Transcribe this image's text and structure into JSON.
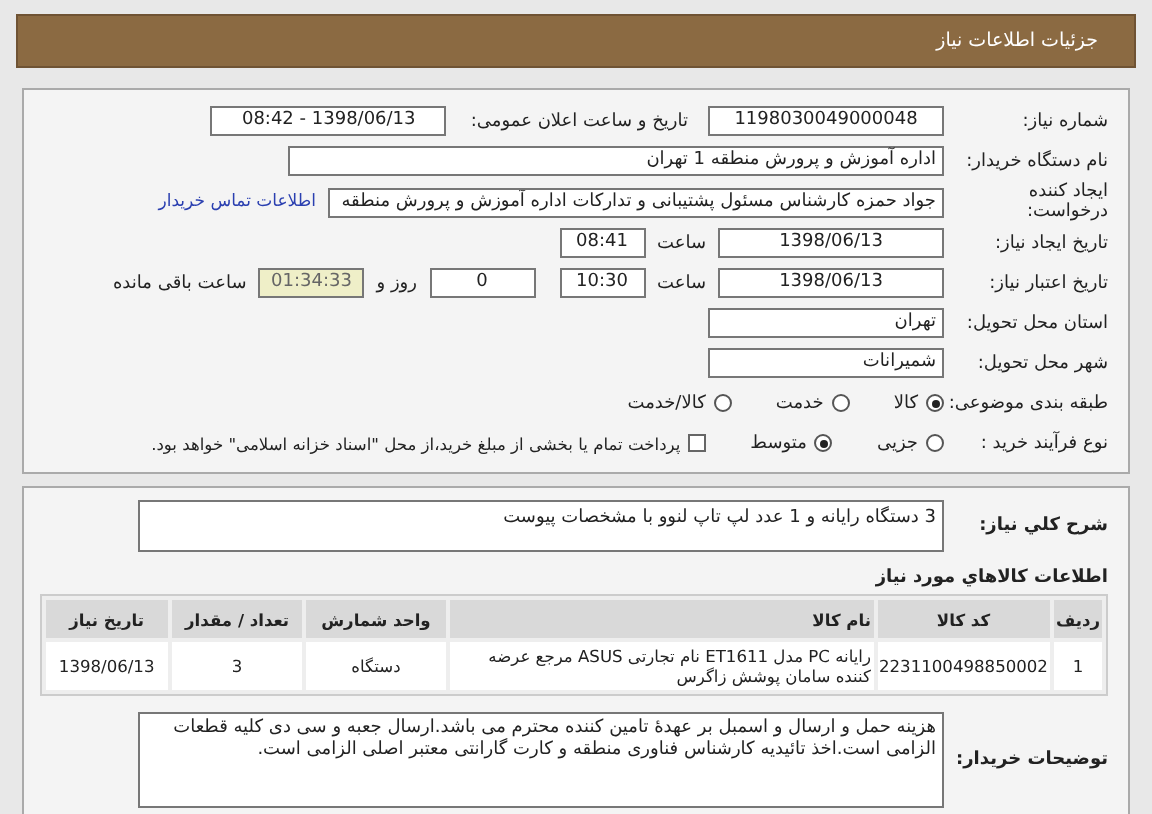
{
  "header": {
    "title": "جزئیات اطلاعات نیاز"
  },
  "need_number": {
    "label": "شماره نیاز:",
    "value": "1198030049000048"
  },
  "announce": {
    "label": "تاریخ و ساعت اعلان عمومی:",
    "value": "1398/06/13 - 08:42"
  },
  "buyer": {
    "label": "نام دستگاه خریدار:",
    "value": "اداره آموزش و پرورش منطقه 1 تهران"
  },
  "creator": {
    "label": "ایجاد کننده درخواست:",
    "value": "جواد حمزه کارشناس مسئول پشتیبانی و تدارکات اداره آموزش و پرورش منطقه",
    "link": "اطلاعات تماس خریدار"
  },
  "created": {
    "label": "تاریخ ایجاد نیاز:",
    "date": "1398/06/13",
    "time_label": "ساعت",
    "time": "08:41"
  },
  "validity": {
    "label": "تاریخ اعتبار نیاز:",
    "date": "1398/06/13",
    "time_label": "ساعت",
    "time": "10:30",
    "days": "0",
    "days_label": "روز و",
    "remaining": "01:34:33",
    "remaining_label": "ساعت باقی مانده"
  },
  "province": {
    "label": "استان محل تحویل:",
    "value": "تهران"
  },
  "city": {
    "label": "شهر محل تحویل:",
    "value": "شمیرانات"
  },
  "category": {
    "label": "طبقه بندی موضوعی:",
    "options": [
      {
        "label": "کالا",
        "selected": true
      },
      {
        "label": "خدمت",
        "selected": false
      },
      {
        "label": "کالا/خدمت",
        "selected": false
      }
    ]
  },
  "purchase": {
    "label": "نوع فرآیند خرید :",
    "options": [
      {
        "label": "جزیی",
        "selected": false
      },
      {
        "label": "متوسط",
        "selected": true
      }
    ],
    "checkbox": {
      "checked": false,
      "label": "پرداخت تمام یا بخشی از مبلغ خرید،از محل \"اسناد خزانه اسلامی\" خواهد بود."
    }
  },
  "summary": {
    "label": "شرح کلي نياز:",
    "value": "3 دستگاه رایانه و 1 عدد لپ تاپ لنوو با مشخصات پیوست"
  },
  "items": {
    "title": "اطلاعات کالاهاي مورد نياز",
    "columns": [
      "ردیف",
      "کد کالا",
      "نام کالا",
      "واحد شمارش",
      "تعداد / مقدار",
      "تاریخ نیاز"
    ],
    "rows": [
      [
        "1",
        "2231100498850002",
        "رایانه PC مدل ET1611 نام تجارتی ASUS مرجع عرضه کننده سامان پوشش زاگرس",
        "دستگاه",
        "3",
        "1398/06/13"
      ]
    ]
  },
  "notes": {
    "label": "توضیحات خریدار:",
    "value": "هزینه حمل و ارسال و اسمبل بر عهدۀ تامین کننده محترم می باشد.ارسال جعبه و سی دی کلیه قطعات الزامی است.اخذ تائیدیه کارشناس فناوری منطقه و کارت گارانتی معتبر  اصلی الزامی است."
  }
}
